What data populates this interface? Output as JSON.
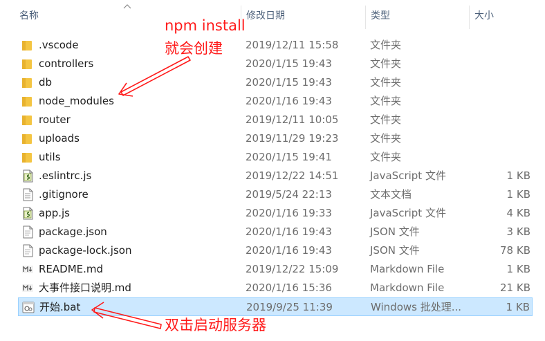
{
  "columns": {
    "name": "名称",
    "date": "修改日期",
    "type": "类型",
    "size": "大小"
  },
  "files": [
    {
      "name": ".vscode",
      "date": "2019/12/11 15:58",
      "type": "文件夹",
      "size": "",
      "icon": "folder-icon"
    },
    {
      "name": "controllers",
      "date": "2020/1/15 19:43",
      "type": "文件夹",
      "size": "",
      "icon": "folder-icon"
    },
    {
      "name": "db",
      "date": "2020/1/15 19:43",
      "type": "文件夹",
      "size": "",
      "icon": "folder-icon"
    },
    {
      "name": "node_modules",
      "date": "2020/1/16 19:43",
      "type": "文件夹",
      "size": "",
      "icon": "folder-icon"
    },
    {
      "name": "router",
      "date": "2019/12/11 10:05",
      "type": "文件夹",
      "size": "",
      "icon": "folder-icon"
    },
    {
      "name": "uploads",
      "date": "2019/11/29 19:23",
      "type": "文件夹",
      "size": "",
      "icon": "folder-icon"
    },
    {
      "name": "utils",
      "date": "2020/1/15 19:41",
      "type": "文件夹",
      "size": "",
      "icon": "folder-icon"
    },
    {
      "name": ".eslintrc.js",
      "date": "2019/12/22 14:51",
      "type": "JavaScript 文件",
      "size": "1 KB",
      "icon": "javascript-file-icon"
    },
    {
      "name": ".gitignore",
      "date": "2019/5/24 22:13",
      "type": "文本文档",
      "size": "1 KB",
      "icon": "text-file-icon"
    },
    {
      "name": "app.js",
      "date": "2020/1/16 19:33",
      "type": "JavaScript 文件",
      "size": "4 KB",
      "icon": "javascript-file-icon"
    },
    {
      "name": "package.json",
      "date": "2020/1/16 19:43",
      "type": "JSON 文件",
      "size": "3 KB",
      "icon": "json-file-icon"
    },
    {
      "name": "package-lock.json",
      "date": "2020/1/16 19:43",
      "type": "JSON 文件",
      "size": "78 KB",
      "icon": "json-file-icon"
    },
    {
      "name": "README.md",
      "date": "2019/12/22 15:09",
      "type": "Markdown File",
      "size": "1 KB",
      "icon": "markdown-file-icon"
    },
    {
      "name": "大事件接口说明.md",
      "date": "2020/1/16 15:36",
      "type": "Markdown File",
      "size": "21 KB",
      "icon": "markdown-file-icon"
    },
    {
      "name": "开始.bat",
      "date": "2019/9/25 11:39",
      "type": "Windows 批处理...",
      "size": "1 KB",
      "icon": "batch-file-icon",
      "selected": true
    }
  ],
  "annotations": {
    "npm_line1": "npm install",
    "npm_line2": "就会创建",
    "bat_note": "双击启动服务器",
    "color": "#ff1a1a"
  },
  "colors": {
    "selected_bg": "#cce8ff",
    "selected_border": "#99d1ff",
    "folder": "#f4c542",
    "header_text": "#4c607a"
  }
}
